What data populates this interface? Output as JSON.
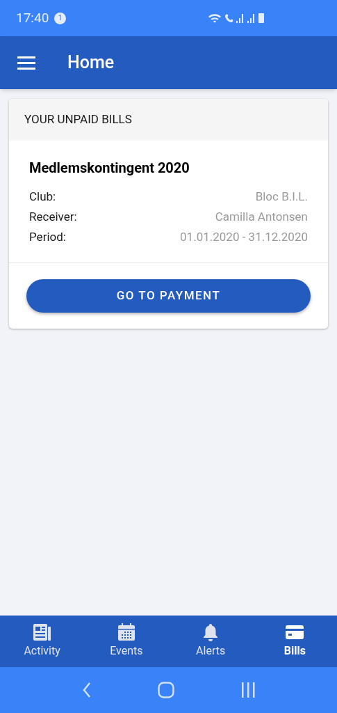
{
  "status_bar": {
    "time": "17:40",
    "notification_count": "1"
  },
  "app_bar": {
    "title": "Home"
  },
  "bills_card": {
    "header": "YOUR UNPAID BILLS",
    "title": "Medlemskontingent 2020",
    "fields": [
      {
        "label": "Club:",
        "value": "Bloc B.I.L."
      },
      {
        "label": "Receiver:",
        "value": "Camilla Antonsen"
      },
      {
        "label": "Period:",
        "value": "01.01.2020 - 31.12.2020"
      }
    ],
    "button": "GO TO PAYMENT"
  },
  "bottom_nav": [
    {
      "label": "Activity",
      "selected": false
    },
    {
      "label": "Events",
      "selected": false
    },
    {
      "label": "Alerts",
      "selected": false
    },
    {
      "label": "Bills",
      "selected": true
    }
  ]
}
